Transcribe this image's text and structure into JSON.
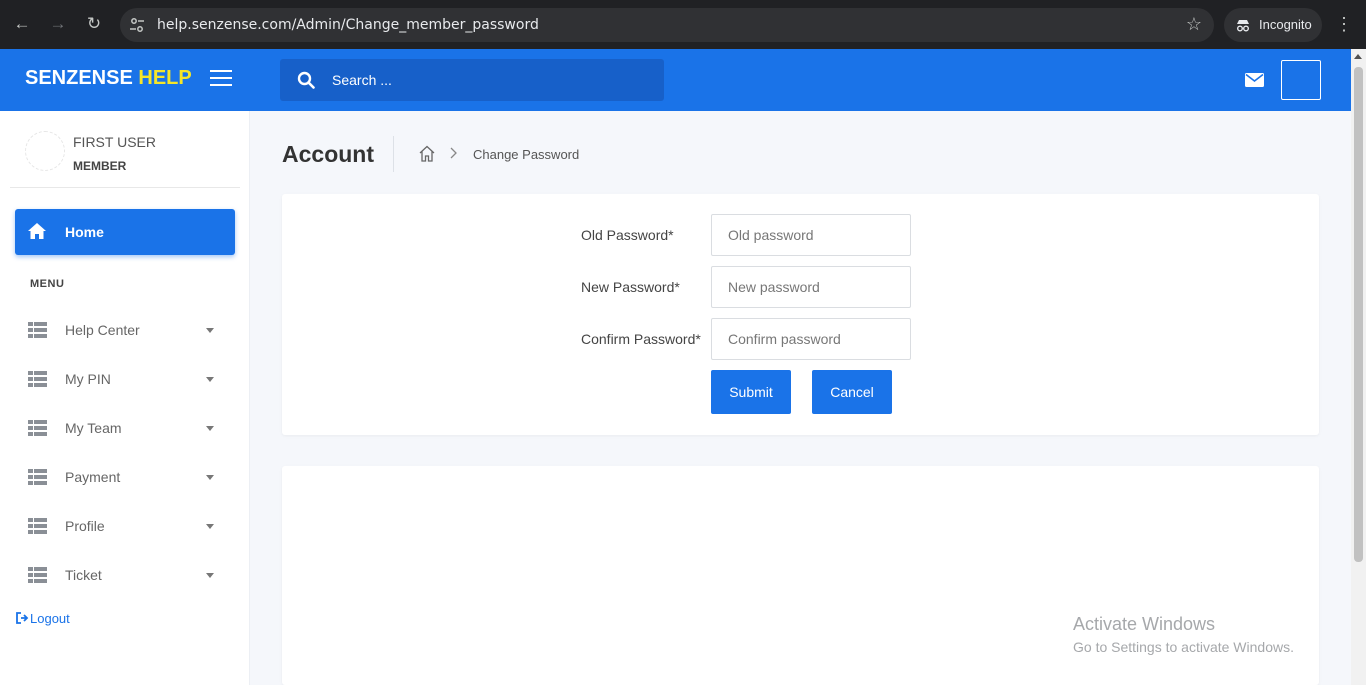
{
  "browser": {
    "url": "help.senzense.com/Admin/Change_member_password",
    "incognito_label": "Incognito"
  },
  "header": {
    "brand_main": "SENZENSE",
    "brand_accent": "HELP",
    "search_placeholder": "Search ..."
  },
  "user": {
    "name": "FIRST USER",
    "role": "MEMBER"
  },
  "sidebar": {
    "home_label": "Home",
    "menu_heading": "MENU",
    "items": [
      {
        "label": "Help Center"
      },
      {
        "label": "My PIN"
      },
      {
        "label": "My Team"
      },
      {
        "label": "Payment"
      },
      {
        "label": "Profile"
      },
      {
        "label": "Ticket"
      }
    ],
    "logout_label": "Logout"
  },
  "page": {
    "title": "Account",
    "breadcrumb_current": "Change Password"
  },
  "form": {
    "old_label": "Old Password*",
    "old_placeholder": "Old password",
    "new_label": "New Password*",
    "new_placeholder": "New password",
    "confirm_label": "Confirm Password*",
    "confirm_placeholder": "Confirm password",
    "submit_label": "Submit",
    "cancel_label": "Cancel"
  },
  "watermark": {
    "line1": "Activate Windows",
    "line2": "Go to Settings to activate Windows."
  },
  "colors": {
    "primary": "#1a73e8",
    "brand_accent": "#f5e629"
  },
  "icons": [
    "back-icon",
    "forward-icon",
    "reload-icon",
    "site-settings-icon",
    "star-icon",
    "incognito-icon",
    "menu-dots-icon",
    "hamburger-icon",
    "search-icon",
    "mail-icon",
    "home-icon",
    "grid-icon",
    "caret-down-icon",
    "logout-icon",
    "breadcrumb-home-icon",
    "chevron-right-icon"
  ]
}
